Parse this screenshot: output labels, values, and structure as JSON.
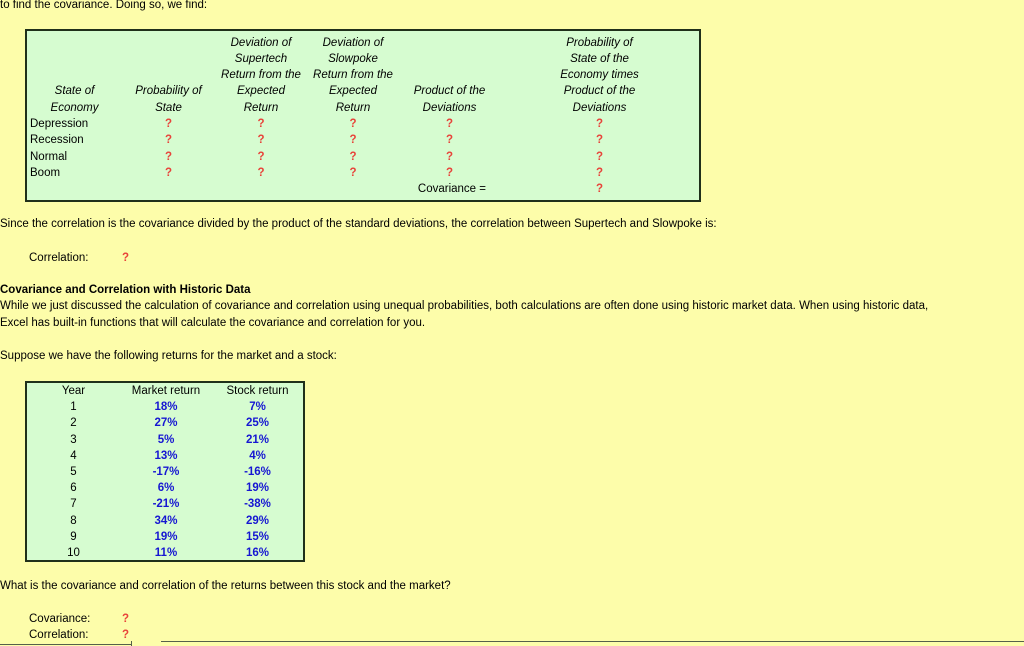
{
  "intro_text": "to find the covariance. Doing so, we find:",
  "covariance_table": {
    "headers": [
      "State of\nEconomy",
      "Probability of\nState",
      "Deviation of\nSupertech\nReturn from the\nExpected\nReturn",
      "Deviation of\nSlowpoke\nReturn from the\nExpected\nReturn",
      "Product of the\nDeviations",
      "Probability of\nState of the\nEconomy times\nProduct of the\nDeviations"
    ],
    "header_lines": {
      "state_of_economy": [
        "State of",
        "Economy"
      ],
      "probability_of_state": [
        "Probability of",
        "State"
      ],
      "deviation_supertech": [
        "Deviation of",
        "Supertech",
        "Return from the",
        "Expected",
        "Return"
      ],
      "deviation_slowpoke": [
        "Deviation of",
        "Slowpoke",
        "Return from the",
        "Expected",
        "Return"
      ],
      "product_of_deviations": [
        "Product of the",
        "Deviations"
      ],
      "probability_times_product": [
        "Probability of",
        "State of the",
        "Economy times",
        "Product of the",
        "Deviations"
      ]
    },
    "rows": [
      {
        "state": "Depression",
        "probability": "?",
        "dev_supertech": "?",
        "dev_slowpoke": "?",
        "product": "?",
        "prob_times_product": "?"
      },
      {
        "state": "Recession",
        "probability": "?",
        "dev_supertech": "?",
        "dev_slowpoke": "?",
        "product": "?",
        "prob_times_product": "?"
      },
      {
        "state": "Normal",
        "probability": "?",
        "dev_supertech": "?",
        "dev_slowpoke": "?",
        "product": "?",
        "prob_times_product": "?"
      },
      {
        "state": "Boom",
        "probability": "?",
        "dev_supertech": "?",
        "dev_slowpoke": "?",
        "product": "?",
        "prob_times_product": "?"
      }
    ],
    "footer_label": "Covariance =",
    "footer_value": "?"
  },
  "correlation_paragraph": "Since the correlation is the covariance divided by the product of the standard deviations, the correlation between Supertech and Slowpoke is:",
  "correlation_row": {
    "label": "Correlation:",
    "value": "?"
  },
  "section_heading": "Covariance and Correlation with Historic Data",
  "section_paragraph_line1": "While we just discussed the calculation of covariance and correlation using unequal probabilities, both calculations are often done using historic market data. When using historic data,",
  "section_paragraph_line2": "Excel has built-in functions that will calculate the covariance and correlation for you.",
  "suppose_text": "Suppose we have the following returns for the market and a stock:",
  "historic_table": {
    "columns": [
      "Year",
      "Market return",
      "Stock return"
    ],
    "rows": [
      {
        "year": "1",
        "market": "18%",
        "stock": "7%"
      },
      {
        "year": "2",
        "market": "27%",
        "stock": "25%"
      },
      {
        "year": "3",
        "market": "5%",
        "stock": "21%"
      },
      {
        "year": "4",
        "market": "13%",
        "stock": "4%"
      },
      {
        "year": "5",
        "market": "-17%",
        "stock": "-16%"
      },
      {
        "year": "6",
        "market": "6%",
        "stock": "19%"
      },
      {
        "year": "7",
        "market": "-21%",
        "stock": "-38%"
      },
      {
        "year": "8",
        "market": "34%",
        "stock": "29%"
      },
      {
        "year": "9",
        "market": "19%",
        "stock": "15%"
      },
      {
        "year": "10",
        "market": "11%",
        "stock": "16%"
      }
    ]
  },
  "question_text": "What is the covariance and correlation of the returns between this stock and the market?",
  "answers": [
    {
      "label": "Covariance:",
      "value": "?"
    },
    {
      "label": "Correlation:",
      "value": "?"
    }
  ],
  "colors": {
    "background": "#fdfdaa",
    "table_fill": "#d6fcd0",
    "table_border": "#20301a",
    "answer_red": "#e8433a",
    "data_blue": "#1616d2",
    "text": "#000000"
  }
}
